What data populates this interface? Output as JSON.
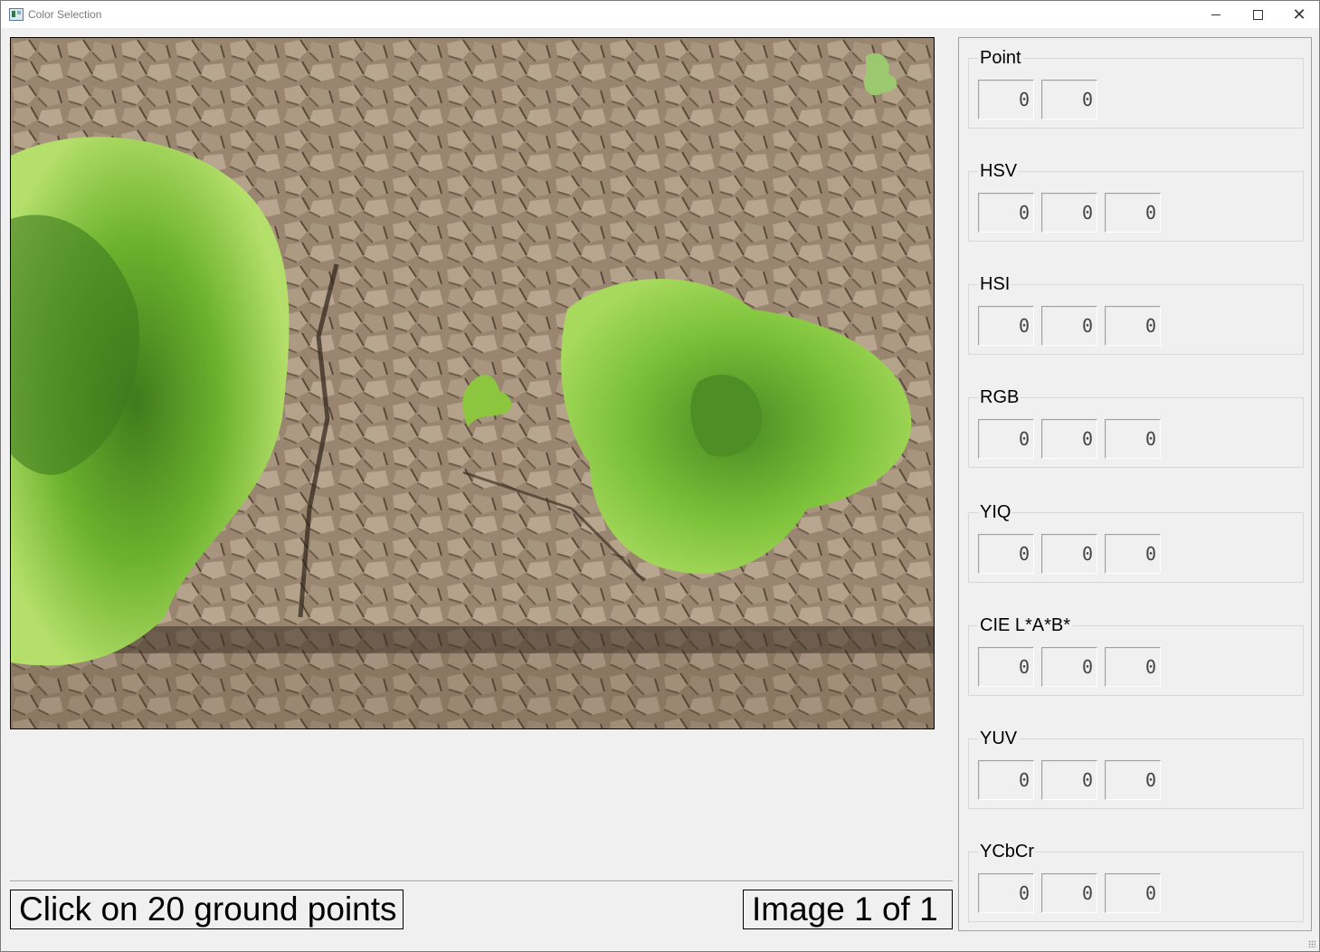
{
  "window": {
    "title": "Color Selection",
    "minimize_icon": "minimize-icon",
    "maximize_icon": "maximize-icon",
    "close_icon": "close-icon",
    "close_glyph": "✕"
  },
  "image": {
    "description_icon": "photo-lettuce-on-soil"
  },
  "status": {
    "instruction": "Click on 20 ground points",
    "counter": "Image 1 of 1"
  },
  "panel": {
    "groups": [
      {
        "label": "Point",
        "values": [
          "0",
          "0"
        ]
      },
      {
        "label": "HSV",
        "values": [
          "0",
          "0",
          "0"
        ]
      },
      {
        "label": "HSI",
        "values": [
          "0",
          "0",
          "0"
        ]
      },
      {
        "label": "RGB",
        "values": [
          "0",
          "0",
          "0"
        ]
      },
      {
        "label": "YIQ",
        "values": [
          "0",
          "0",
          "0"
        ]
      },
      {
        "label": "CIE L*A*B*",
        "values": [
          "0",
          "0",
          "0"
        ]
      },
      {
        "label": "YUV",
        "values": [
          "0",
          "0",
          "0"
        ]
      },
      {
        "label": "YCbCr",
        "values": [
          "0",
          "0",
          "0"
        ]
      }
    ]
  }
}
